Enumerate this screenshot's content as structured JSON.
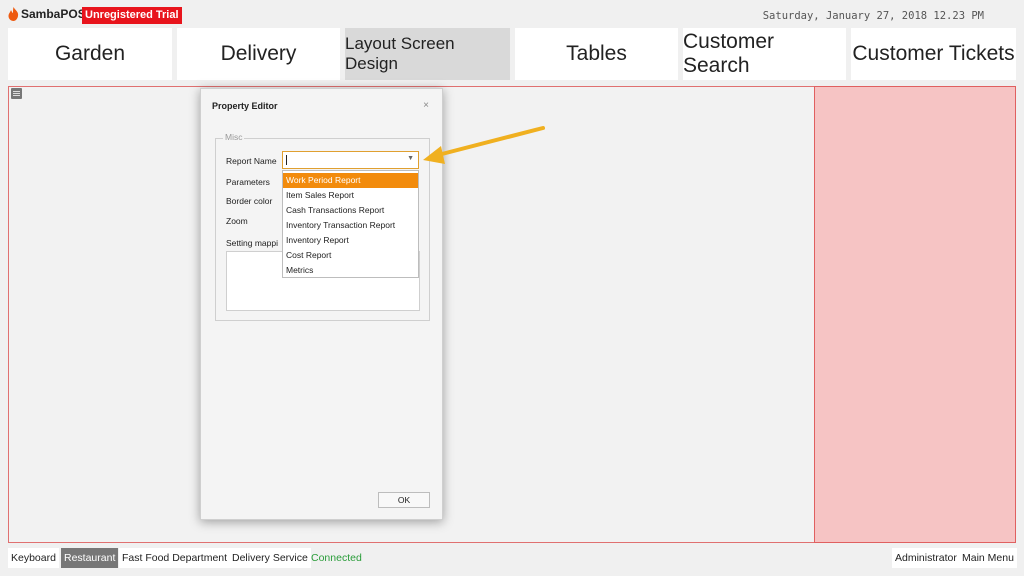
{
  "app": {
    "logo_text": "SambaPOS",
    "trial_badge": "Unregistered Trial",
    "datetime": "Saturday, January 27, 2018 12.23 PM"
  },
  "main_tabs": [
    {
      "label": "Garden"
    },
    {
      "label": "Delivery"
    },
    {
      "label": "Layout Screen Design",
      "active": true
    },
    {
      "label": "Tables"
    },
    {
      "label": "Customer Search"
    },
    {
      "label": "Customer Tickets"
    }
  ],
  "dialog": {
    "title": "Property Editor",
    "close": "×",
    "group_label": "Misc",
    "properties": {
      "report_name": "Report Name",
      "parameters": "Parameters",
      "border_color": "Border color",
      "zoom": "Zoom",
      "setting_mappings": "Setting mappi"
    },
    "report_name_value": "",
    "dropdown_options": [
      "Work Period Report",
      "Item Sales Report",
      "Cash Transactions Report",
      "Inventory Transaction Report",
      "Inventory Report",
      "Cost Report",
      "Metrics"
    ],
    "selected_option": "Work Period Report",
    "ok_label": "OK"
  },
  "status_bar": {
    "keyboard": "Keyboard",
    "restaurant": "Restaurant",
    "fast_food": "Fast Food Department",
    "delivery_service": "Delivery Service",
    "connection": "Connected",
    "user": "Administrator",
    "main_menu": "Main Menu"
  },
  "colors": {
    "trial_badge": "#e8141c",
    "selected_option": "#f28b0c",
    "annotation_arrow": "#f0b020",
    "red_panel": "#f6c4c4",
    "connected": "#2a9d3a"
  },
  "icons": {
    "logo": "sambapos-flame-icon",
    "layout_menu": "menu-icon",
    "dropdown": "chevron-down-icon",
    "close": "close-icon"
  }
}
